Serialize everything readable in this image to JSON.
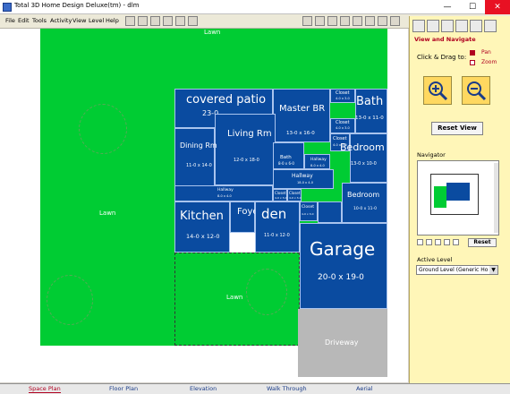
{
  "window": {
    "title": "Total 3D Home Design Deluxe(tm) - dlm",
    "minimize": "—",
    "maximize": "☐",
    "close": "✕"
  },
  "menu": [
    "File",
    "Edit",
    "Tools",
    "Activity",
    "View",
    "Level",
    "Help"
  ],
  "plan": {
    "lawn_top": "Lawn",
    "lawn_left": "Lawn",
    "lawn_front": "Lawn",
    "rooms": [
      {
        "name": "covered patio",
        "dims": "23-0"
      },
      {
        "name": "Master BR",
        "dims": "13-0 x 16-0"
      },
      {
        "name": "Closet",
        "dims": "4-0 x 3-0"
      },
      {
        "name": "Bath",
        "dims": "13-0 x 11-0"
      },
      {
        "name": "Closet",
        "dims": "4-0 x 3-0"
      },
      {
        "name": "Living Rm",
        "dims": "12-0 x 18-0"
      },
      {
        "name": "Dining Rm",
        "dims": "11-0 x 14-0"
      },
      {
        "name": "Bath",
        "dims": "8-0 x 6-0"
      },
      {
        "name": "Hallway",
        "dims": "8-0 x 4-0"
      },
      {
        "name": "Closet",
        "dims": "4-0 x 3-0"
      },
      {
        "name": "Bedroom",
        "dims": "13-0 x 10-0"
      },
      {
        "name": "Hallway",
        "dims": "18-0 x 4-0"
      },
      {
        "name": "Hallway",
        "dims": "8-0 x 4-0"
      },
      {
        "name": "Closet",
        "dims": "4-0 x 3-0"
      },
      {
        "name": "Closet",
        "dims": "4-0 x 3-0"
      },
      {
        "name": "Bedroom",
        "dims": "10-0 x 11-0"
      },
      {
        "name": "Kitchen",
        "dims": "14-0 x 12-0"
      },
      {
        "name": "Foyer",
        "dims": ""
      },
      {
        "name": "den",
        "dims": "11-0 x 12-0"
      },
      {
        "name": "Closet",
        "dims": "4-0 x 3-0"
      },
      {
        "name": "Garage",
        "dims": "20-0 x 19-0"
      },
      {
        "name": "Driveway",
        "dims": ""
      }
    ]
  },
  "panel": {
    "heading": "View and Navigate",
    "click_drag": "Click & Drag to:",
    "pan": "Pan",
    "zoom": "Zoom",
    "reset_view": "Reset View",
    "navigator": "Navigator",
    "reset": "Reset",
    "active_level": "Active Level",
    "level_value": "Ground Level (Generic Ho"
  },
  "tabs": [
    "Space Plan",
    "Floor Plan",
    "Elevation",
    "Walk Through",
    "Aerial"
  ],
  "colors": {
    "lawn": "#00cc33",
    "room": "#0a4ba0",
    "panel": "#fff6b8",
    "active_tab": "#b00020"
  }
}
